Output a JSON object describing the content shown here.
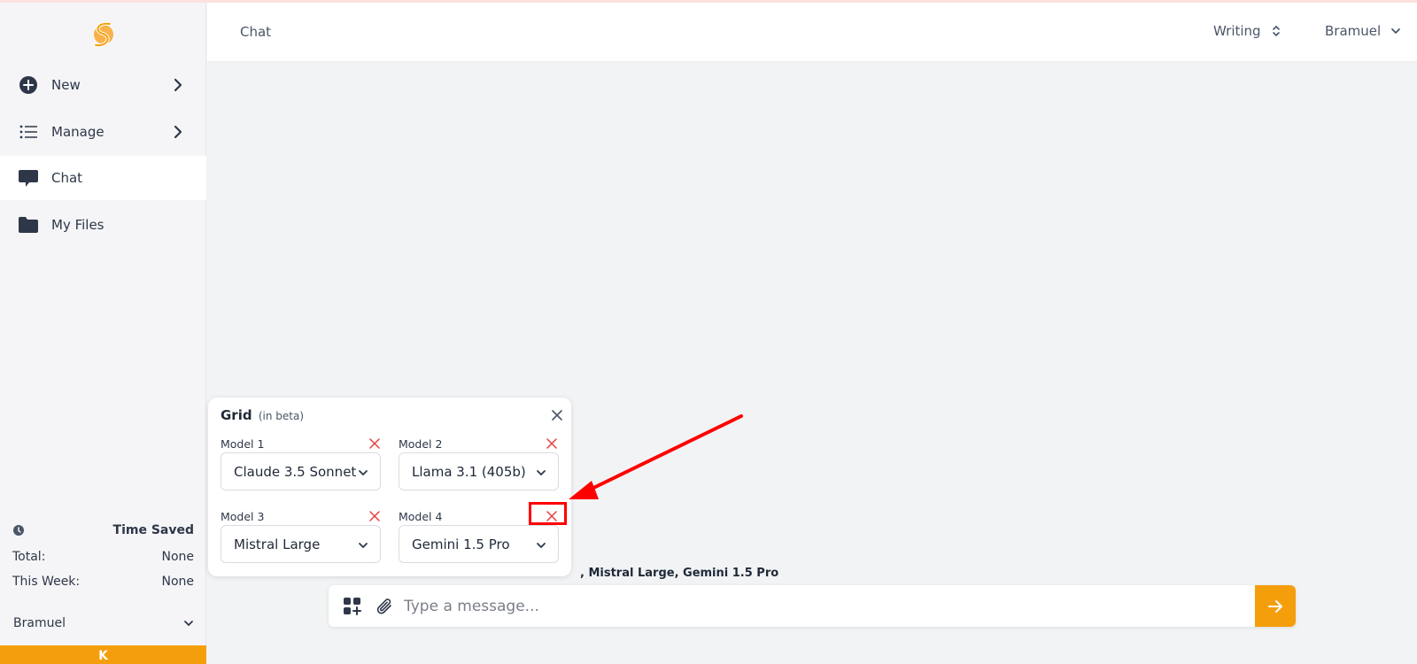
{
  "sidebar": {
    "items": [
      {
        "label": "New"
      },
      {
        "label": "Manage"
      },
      {
        "label": "Chat"
      },
      {
        "label": "My Files"
      }
    ],
    "time_saved": {
      "title": "Time Saved",
      "total_label": "Total:",
      "total_value": "None",
      "week_label": "This Week:",
      "week_value": "None"
    },
    "user": "Bramuel",
    "bottom_char": "K"
  },
  "header": {
    "crumb": "Chat",
    "mode": "Writing",
    "user": "Bramuel"
  },
  "grid": {
    "title": "Grid",
    "beta": "(in beta)",
    "slots": [
      {
        "label": "Model 1",
        "model": "Claude 3.5 Sonnet"
      },
      {
        "label": "Model 2",
        "model": "Llama 3.1 (405b)"
      },
      {
        "label": "Model 3",
        "model": "Mistral Large"
      },
      {
        "label": "Model 4",
        "model": "Gemini 1.5 Pro"
      }
    ]
  },
  "selected_models_text": ", Mistral Large, Gemini 1.5 Pro",
  "chat": {
    "placeholder": "Type a message..."
  },
  "colors": {
    "accent": "#f59e0b",
    "remove": "#e53e3e",
    "annotation": "#ff0000"
  }
}
